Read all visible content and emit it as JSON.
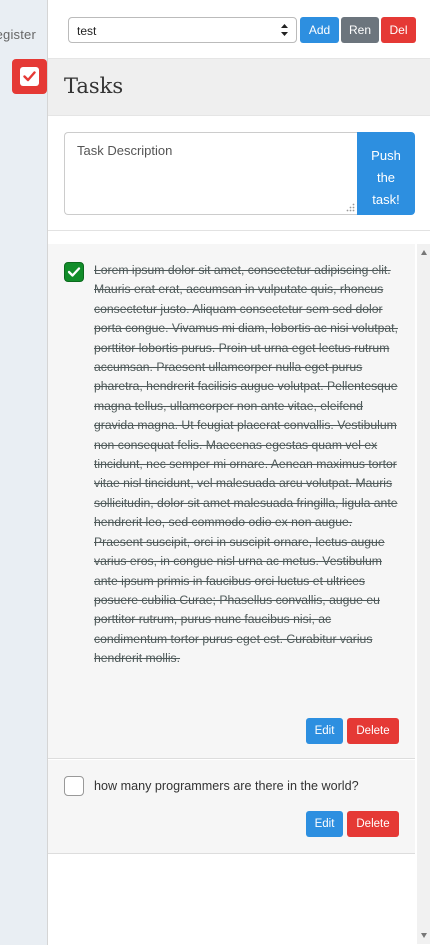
{
  "backdrop": {
    "register_label": "Register"
  },
  "toolbar": {
    "list_selected": "test",
    "add_label": "Add",
    "rename_label": "Ren",
    "delete_label": "Del"
  },
  "header": {
    "title": "Tasks"
  },
  "compose": {
    "placeholder": "Task Description",
    "push_label_1": "Push",
    "push_label_2": "the",
    "push_label_3": "task!"
  },
  "tasks": [
    {
      "done": true,
      "text": "Lorem ipsum dolor sit amet, consectetur adipiscing elit. Mauris erat erat, accumsan in vulputate quis, rhoncus consectetur justo. Aliquam consectetur sem sed dolor porta congue. Vivamus mi diam, lobortis ac nisi volutpat, porttitor lobortis purus. Proin ut urna eget lectus rutrum accumsan. Praesent ullamcorper nulla eget purus pharetra, hendrerit facilisis augue volutpat. Pellentesque magna tellus, ullamcorper non ante vitae, eleifend gravida magna. Ut feugiat placerat convallis. Vestibulum non consequat felis. Maecenas egestas quam vel ex tincidunt, nec semper mi ornare. Aenean maximus tortor vitae nisl tincidunt, vel malesuada arcu volutpat. Mauris sollicitudin, dolor sit amet malesuada fringilla, ligula ante hendrerit leo, sed commodo odio ex non augue. Praesent suscipit, orci in suscipit ornare, lectus augue varius eros, in congue nisl urna ac metus. Vestibulum ante ipsum primis in faucibus orci luctus et ultrices posuere cubilia Curae; Phasellus convallis, augue eu porttitor rutrum, purus nunc faucibus nisi, ac condimentum tortor purus eget est. Curabitur varius hendrerit mollis.",
      "edit_label": "Edit",
      "delete_label": "Delete"
    },
    {
      "done": false,
      "text": "how many programmers are there in the world?",
      "edit_label": "Edit",
      "delete_label": "Delete"
    }
  ],
  "colors": {
    "primary": "#2d8fe0",
    "secondary": "#6c757d",
    "danger": "#e53935",
    "check_done": "#118d2a"
  }
}
